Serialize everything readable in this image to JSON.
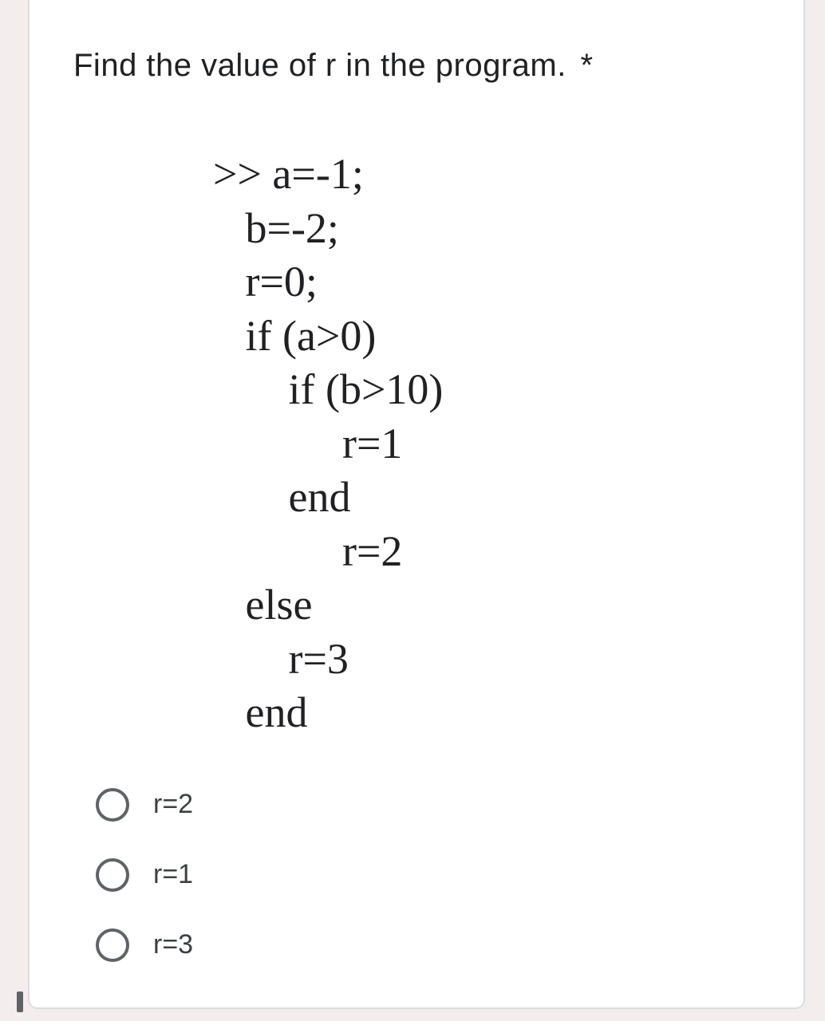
{
  "question": {
    "text": "Find the value of r in the program.",
    "required_mark": "*"
  },
  "code": {
    "l1": ">> a=-1;",
    "l2": "   b=-2;",
    "l3": "   r=0;",
    "l4": "   if (a>0)",
    "l5": "       if (b>10)",
    "l6": "            r=1",
    "l7": "       end",
    "l8": "            r=2",
    "l9": "   else",
    "l10": "       r=3",
    "l11": "   end"
  },
  "options": [
    {
      "label": "r=2"
    },
    {
      "label": "r=1"
    },
    {
      "label": "r=3"
    }
  ]
}
